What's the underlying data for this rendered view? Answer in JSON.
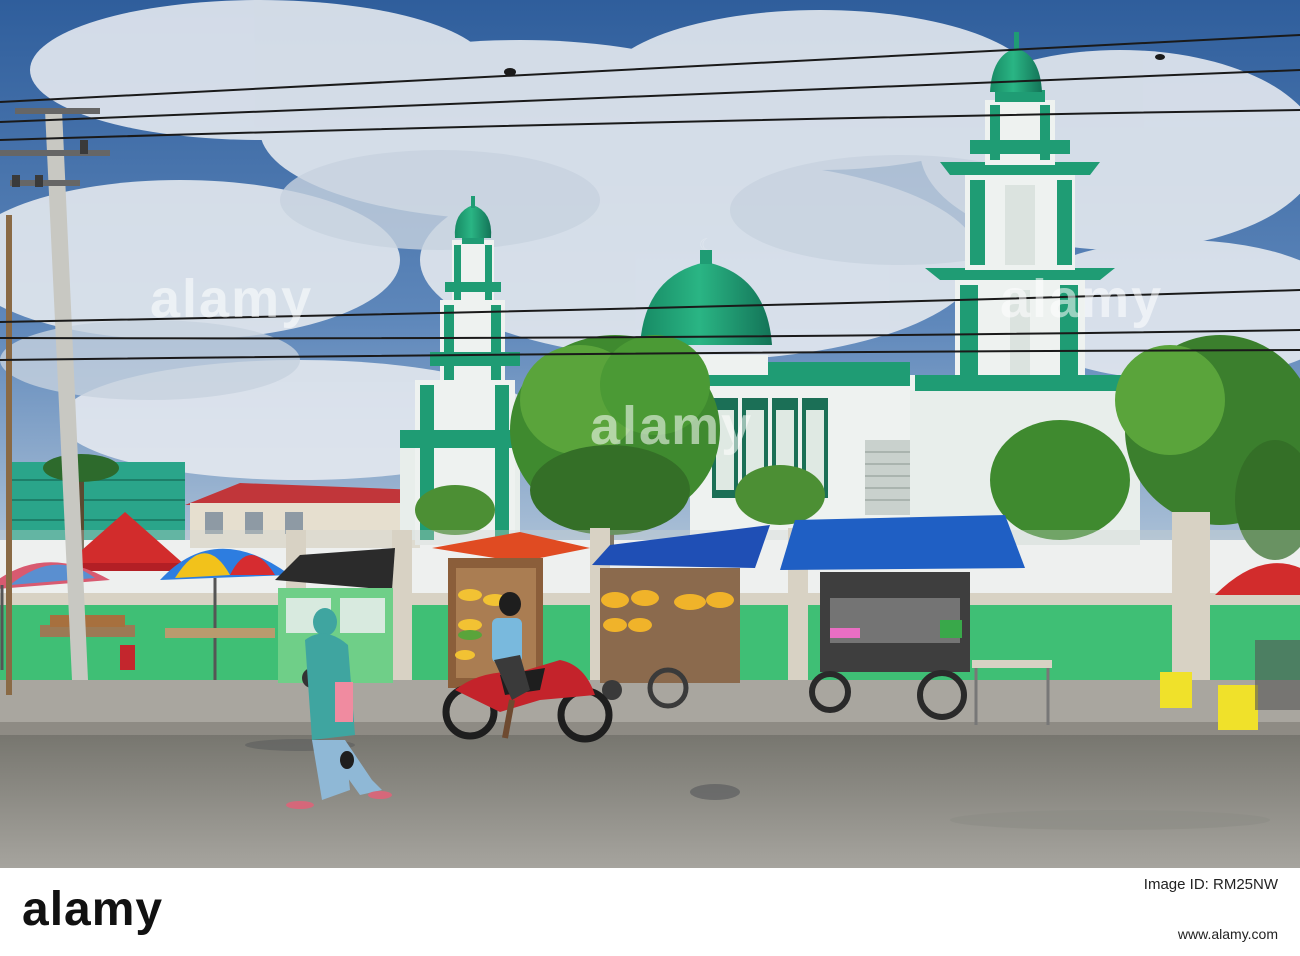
{
  "watermark": {
    "text": "alamy"
  },
  "footer": {
    "logo_text": "alamy",
    "image_id_label": "Image ID: RM25NW",
    "url_text": "www.alamy.com"
  },
  "colors": {
    "sky": "#3f6ea8",
    "cloud": "#dfe6ee",
    "mosque_green": "#1f9c74",
    "mosque_white": "#eef2f0",
    "wall_green": "#3fbf75",
    "road": "#8b8a85",
    "tarp_blue": "#1f4fb5",
    "tarp_red": "#d22c2c"
  },
  "icons": [
    "crescent-icon"
  ]
}
